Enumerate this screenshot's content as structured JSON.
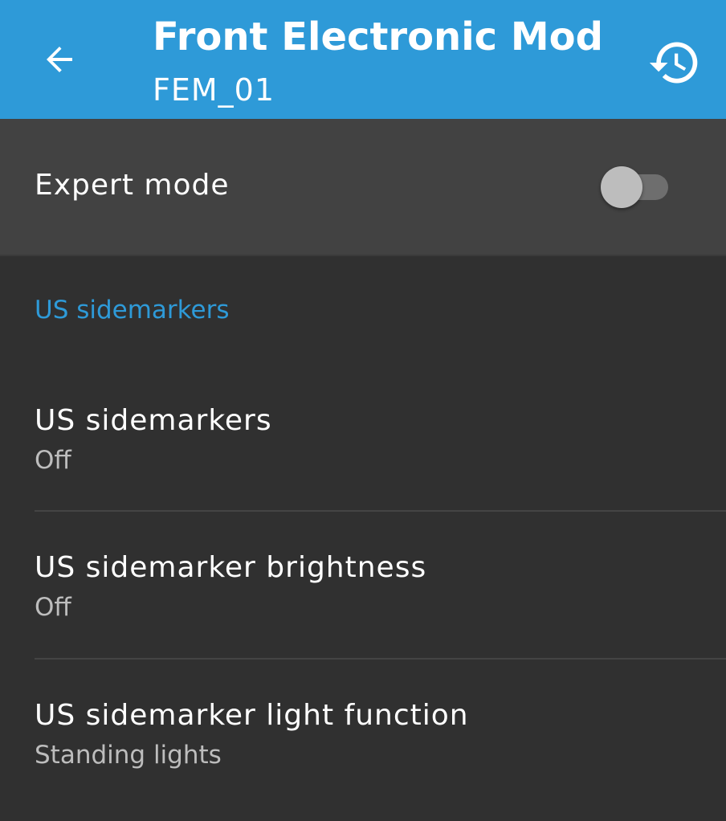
{
  "appbar": {
    "title": "Front Electronic Mod...",
    "subtitle": "FEM_01",
    "back_icon": "arrow-left-icon",
    "history_icon": "history-icon",
    "color": "#2e9ad8"
  },
  "expert_mode": {
    "label": "Expert mode",
    "enabled": false
  },
  "section": {
    "header": "US sidemarkers",
    "accent_color": "#2e9ad8"
  },
  "preferences": [
    {
      "title": "US sidemarkers",
      "summary": "Off"
    },
    {
      "title": "US sidemarker brightness",
      "summary": "Off"
    },
    {
      "title": "US sidemarker light function",
      "summary": "Standing lights"
    }
  ]
}
